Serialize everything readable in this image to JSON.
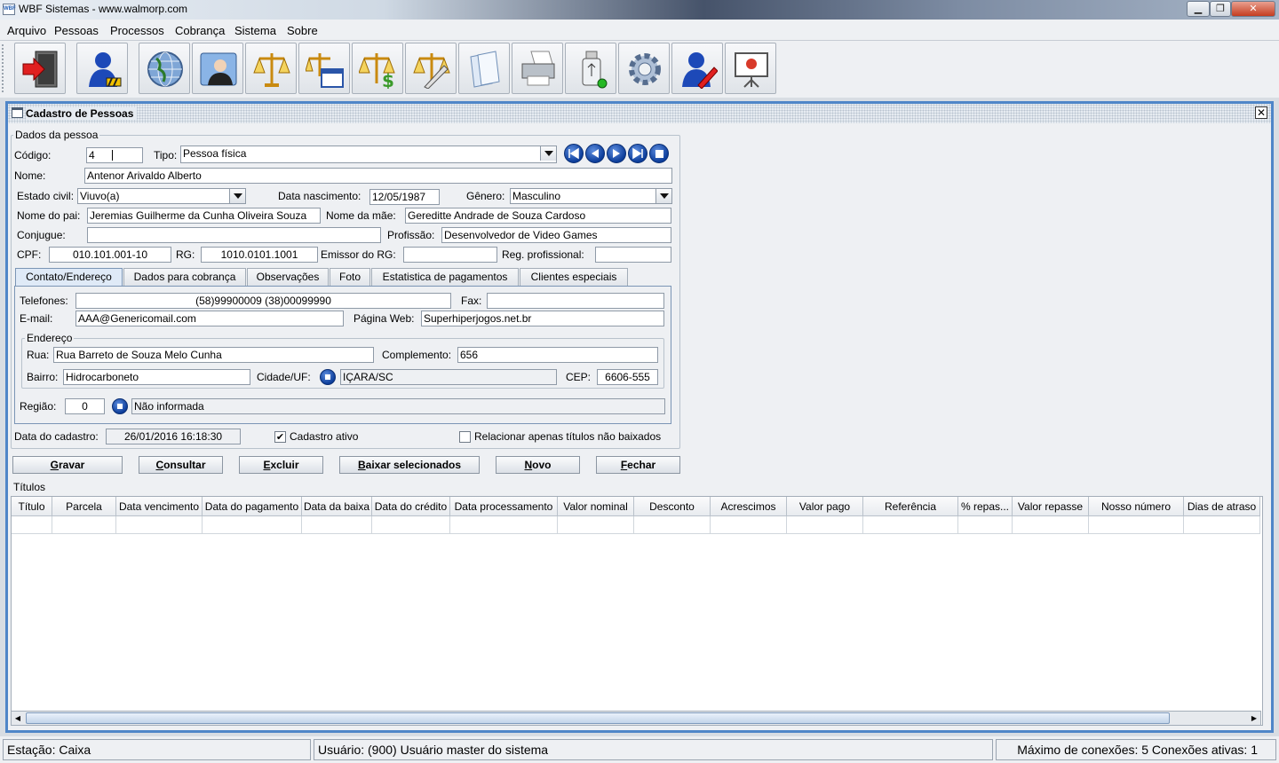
{
  "window": {
    "title": "WBF Sistemas - www.walmorp.com",
    "logo": "WBF"
  },
  "menu": [
    "Arquivo",
    "Pessoas",
    "Processos",
    "Cobrança",
    "Sistema",
    "Sobre"
  ],
  "toolbar_icons": [
    "exit-icon",
    "person-icon",
    "globe-icon",
    "contact-photo-icon",
    "scales-icon",
    "scales-window-icon",
    "scales-money-icon",
    "scales-edit-icon",
    "documents-icon",
    "printer-icon",
    "usb-drive-icon",
    "settings-gear-icon",
    "user-edit-icon",
    "presentation-icon"
  ],
  "frame": {
    "title": "Cadastro de Pessoas"
  },
  "dados": {
    "group_title": "Dados da pessoa",
    "codigo_label": "Código:",
    "codigo": "4",
    "tipo_label": "Tipo:",
    "tipo": "Pessoa física",
    "nome_label": "Nome:",
    "nome": "Antenor Arivaldo Alberto",
    "estado_civil_label": "Estado civil:",
    "estado_civil": "Viuvo(a)",
    "nascimento_label": "Data nascimento:",
    "nascimento": "12/05/1987",
    "genero_label": "Gênero:",
    "genero": "Masculino",
    "pai_label": "Nome do pai:",
    "pai": "Jeremias Guilherme da Cunha Oliveira Souza",
    "mae_label": "Nome da mãe:",
    "mae": "Gereditte Andrade de Souza Cardoso",
    "conjugue_label": "Conjugue:",
    "conjugue": "",
    "profissao_label": "Profissão:",
    "profissao": "Desenvolvedor de Video Games",
    "cpf_label": "CPF:",
    "cpf": "010.101.001-10",
    "rg_label": "RG:",
    "rg": "1010.0101.1001",
    "emissor_label": "Emissor do RG:",
    "emissor": "",
    "reg_label": "Reg. profissional:",
    "reg": ""
  },
  "tabs": [
    "Contato/Endereço",
    "Dados para cobrança",
    "Observações",
    "Foto",
    "Estatistica de pagamentos",
    "Clientes especiais"
  ],
  "contato": {
    "telefones_label": "Telefones:",
    "telefones": "(58)99900009 (38)00099990",
    "fax_label": "Fax:",
    "fax": "",
    "email_label": "E-mail:",
    "email": "AAA@Genericomail.com",
    "web_label": "Página Web:",
    "web": "Superhiperjogos.net.br",
    "endereco_title": "Endereço",
    "rua_label": "Rua:",
    "rua": "Rua Barreto de Souza Melo Cunha",
    "complemento_label": "Complemento:",
    "complemento": "656",
    "bairro_label": "Bairro:",
    "bairro": "Hidrocarboneto",
    "cidade_label": "Cidade/UF:",
    "cidade": "IÇARA/SC",
    "cep_label": "CEP:",
    "cep": "6606-555",
    "regiao_label": "Região:",
    "regiao": "0",
    "regiao_desc": "Não informada"
  },
  "cadastro": {
    "data_label": "Data do cadastro:",
    "data": "26/01/2016 16:18:30",
    "ativo_label": "Cadastro ativo",
    "ativo_mark": "✔",
    "relacionar_label": "Relacionar apenas títulos não baixados",
    "relacionar_mark": ""
  },
  "buttons": [
    {
      "mn": "G",
      "rest": "ravar"
    },
    {
      "mn": "C",
      "rest": "onsultar"
    },
    {
      "mn": "E",
      "rest": "xcluir"
    },
    {
      "mn": "B",
      "rest": "aixar selecionados"
    },
    {
      "mn": "N",
      "rest": "ovo"
    },
    {
      "mn": "F",
      "rest": "echar"
    }
  ],
  "titulos": {
    "title": "Títulos",
    "columns": [
      "Título",
      "Parcela",
      "Data vencimento",
      "Data do pagamento",
      "Data da baixa",
      "Data do crédito",
      "Data processamento",
      "Valor nominal",
      "Desconto",
      "Acrescimos",
      "Valor pago",
      "Referência",
      "% repas...",
      "Valor repasse",
      "Nosso número",
      "Dias de atraso"
    ]
  },
  "status": {
    "estacao": "Estação: Caixa",
    "usuario": "Usuário: (900) Usuário master do sistema",
    "conexoes": "Máximo de conexões: 5 Conexões ativas: 1"
  }
}
